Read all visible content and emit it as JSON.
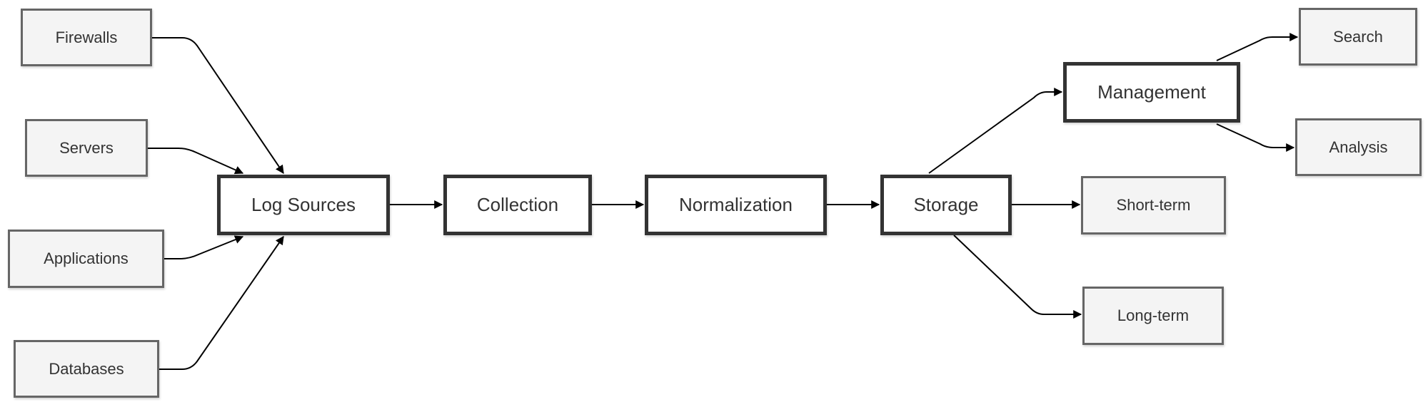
{
  "diagram": {
    "type": "flowchart",
    "direction": "left-to-right",
    "nodes": [
      {
        "id": "firewalls",
        "label": "Firewalls",
        "style": "secondary"
      },
      {
        "id": "servers",
        "label": "Servers",
        "style": "secondary"
      },
      {
        "id": "applications",
        "label": "Applications",
        "style": "secondary"
      },
      {
        "id": "databases",
        "label": "Databases",
        "style": "secondary"
      },
      {
        "id": "log_sources",
        "label": "Log Sources",
        "style": "primary"
      },
      {
        "id": "collection",
        "label": "Collection",
        "style": "primary"
      },
      {
        "id": "normalization",
        "label": "Normalization",
        "style": "primary"
      },
      {
        "id": "storage",
        "label": "Storage",
        "style": "primary"
      },
      {
        "id": "management",
        "label": "Management",
        "style": "primary"
      },
      {
        "id": "short_term",
        "label": "Short-term",
        "style": "secondary"
      },
      {
        "id": "long_term",
        "label": "Long-term",
        "style": "secondary"
      },
      {
        "id": "search",
        "label": "Search",
        "style": "secondary"
      },
      {
        "id": "analysis",
        "label": "Analysis",
        "style": "secondary"
      }
    ],
    "edges": [
      {
        "from": "firewalls",
        "to": "log_sources"
      },
      {
        "from": "servers",
        "to": "log_sources"
      },
      {
        "from": "applications",
        "to": "log_sources"
      },
      {
        "from": "databases",
        "to": "log_sources"
      },
      {
        "from": "log_sources",
        "to": "collection"
      },
      {
        "from": "collection",
        "to": "normalization"
      },
      {
        "from": "normalization",
        "to": "storage"
      },
      {
        "from": "storage",
        "to": "management"
      },
      {
        "from": "storage",
        "to": "short_term"
      },
      {
        "from": "storage",
        "to": "long_term"
      },
      {
        "from": "management",
        "to": "search"
      },
      {
        "from": "management",
        "to": "analysis"
      }
    ],
    "colors": {
      "primary_border": "#333333",
      "primary_fill": "#ffffff",
      "secondary_border": "#666666",
      "secondary_fill": "#f4f4f4",
      "edge": "#000000",
      "text": "#333333"
    }
  }
}
